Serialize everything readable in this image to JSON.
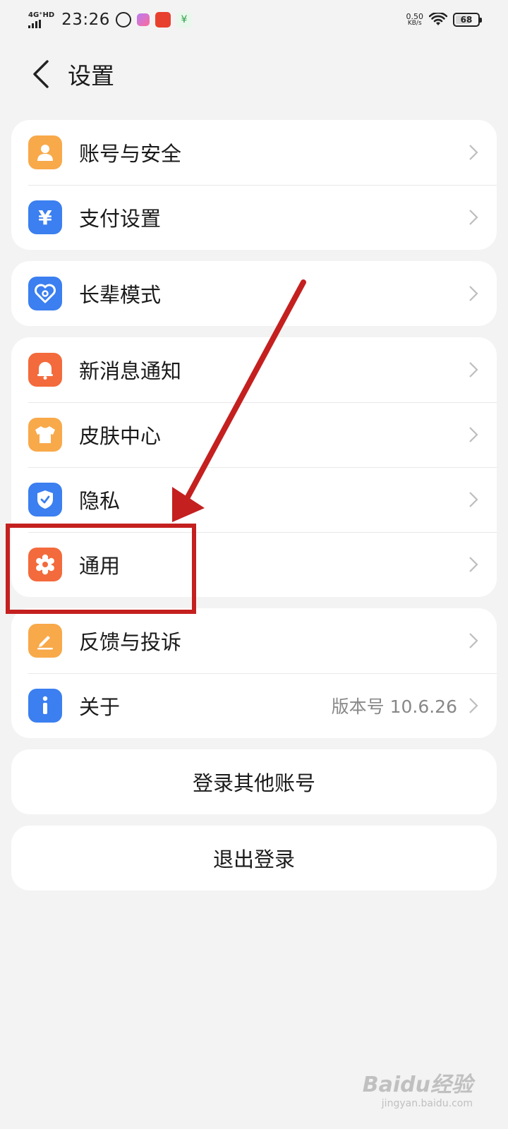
{
  "status_bar": {
    "network": "4G⁺HD",
    "time": "23:26",
    "speed_value": "0.50",
    "speed_unit": "KB/s",
    "battery": "68",
    "battery_level": 0.68
  },
  "header": {
    "back_icon": "chevron-left-icon",
    "title": "设置"
  },
  "groups": [
    {
      "items": [
        {
          "label": "账号与安全",
          "icon": "person-icon",
          "color": "#f8a94a"
        },
        {
          "label": "支付设置",
          "icon": "yuan-icon",
          "color": "#3b7ff0"
        }
      ]
    },
    {
      "items": [
        {
          "label": "长辈模式",
          "icon": "heart-icon",
          "color": "#3b7ff0"
        }
      ]
    },
    {
      "items": [
        {
          "label": "新消息通知",
          "icon": "bell-icon",
          "color": "#f36a3c"
        },
        {
          "label": "皮肤中心",
          "icon": "shirt-icon",
          "color": "#f8a94a"
        },
        {
          "label": "隐私",
          "icon": "shield-icon",
          "color": "#3b7ff0"
        },
        {
          "label": "通用",
          "icon": "gear-icon",
          "color": "#f36a3c"
        }
      ]
    },
    {
      "items": [
        {
          "label": "反馈与投诉",
          "icon": "pencil-icon",
          "color": "#f8a94a"
        },
        {
          "label": "关于",
          "icon": "info-icon",
          "color": "#3b7ff0",
          "value": "版本号 10.6.26"
        }
      ]
    }
  ],
  "actions": {
    "switch_account": "登录其他账号",
    "logout": "退出登录"
  },
  "annotation": {
    "color": "#c4201f"
  },
  "watermark": {
    "main": "Baidu经验",
    "sub": "jingyan.baidu.com"
  }
}
